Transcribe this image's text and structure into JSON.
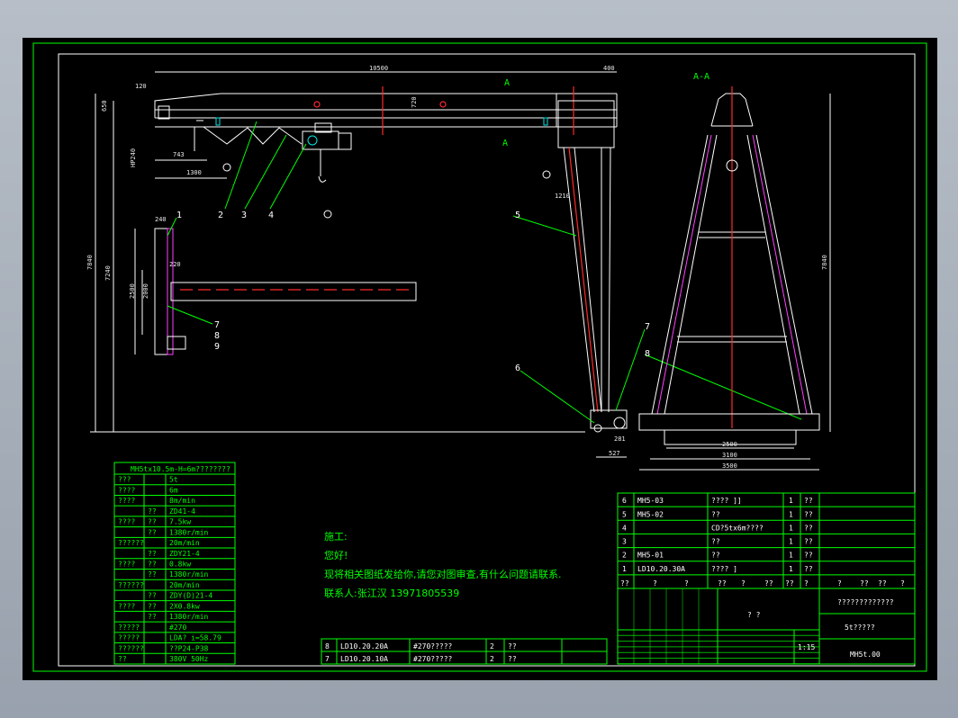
{
  "drawing": {
    "section_label": "A-A",
    "section_mark": "A",
    "overall_width": "10500",
    "overall_width_right": "400",
    "dims_left": [
      "120",
      "650",
      "HP240",
      "743",
      "1300"
    ],
    "dim_small": "1210",
    "dim_center": "720",
    "height_total": "7840",
    "height_inner": "7240",
    "height_right": "7840",
    "plan_dims": [
      "240",
      "220",
      "2500",
      "2000"
    ],
    "base_dims": [
      "281",
      "527"
    ],
    "aa_base_dims": [
      "2500",
      "3100",
      "3500"
    ],
    "part_callouts": [
      "1",
      "2",
      "3",
      "4",
      "5",
      "6",
      "7",
      "8",
      "9"
    ]
  },
  "spec_table": {
    "title": "MH5tx10.5m-H=6m????????",
    "rows": [
      {
        "a": "???",
        "b": "",
        "c": "5t"
      },
      {
        "a": "????",
        "b": "",
        "c": "6m"
      },
      {
        "a": "????",
        "b": "",
        "c": "8m/min"
      },
      {
        "a": "",
        "b": "??",
        "c": "ZD41-4"
      },
      {
        "a": "????",
        "b": "??",
        "c": "7.5kw"
      },
      {
        "a": "",
        "b": "??",
        "c": "1380r/min"
      },
      {
        "a": "??????",
        "b": "",
        "c": "20m/min"
      },
      {
        "a": "",
        "b": "??",
        "c": "ZDY21-4"
      },
      {
        "a": "????",
        "b": "??",
        "c": "0.8kw"
      },
      {
        "a": "",
        "b": "??",
        "c": "1380r/min"
      },
      {
        "a": "??????",
        "b": "",
        "c": "20m/min"
      },
      {
        "a": "",
        "b": "??",
        "c": "ZDY(D)21-4"
      },
      {
        "a": "????",
        "b": "??",
        "c": "2X0.8kw"
      },
      {
        "a": "",
        "b": "??",
        "c": "1380r/min"
      },
      {
        "a": "?????",
        "b": "",
        "c": "#270"
      },
      {
        "a": "?????",
        "b": "",
        "c": "LDA?  i=58.79"
      },
      {
        "a": "??????",
        "b": "",
        "c": "??P24-P38"
      },
      {
        "a": "??",
        "b": "",
        "c": "380V    50Hz"
      }
    ]
  },
  "note": {
    "l1": "施工:",
    "l2": "您好!",
    "l3": "现将相关图纸发给你,请您对图审查,有什么问题请联系.",
    "l4": "联系人:张江汉   13971805539"
  },
  "bom_top": [
    {
      "n": "6",
      "code": "MH5-03",
      "name": "???? ]]",
      "q": "1",
      "x": "??"
    },
    {
      "n": "5",
      "code": "MH5-02",
      "name": "??",
      "q": "1",
      "x": "??"
    },
    {
      "n": "4",
      "code": "",
      "name": "CD?5tx6m????",
      "q": "1",
      "x": "??"
    },
    {
      "n": "3",
      "code": "",
      "name": "??",
      "q": "1",
      "x": "??"
    },
    {
      "n": "2",
      "code": "MH5-01",
      "name": "??",
      "q": "1",
      "x": "??"
    },
    {
      "n": "1",
      "code": "LD10.20.30A",
      "name": "???? ]",
      "q": "1",
      "x": "??"
    }
  ],
  "bom_bottom": [
    {
      "n": "8",
      "code": "LD10.20.20A",
      "name": "#270?????",
      "q": "2",
      "x": "??"
    },
    {
      "n": "7",
      "code": "LD10.20.10A",
      "name": "#270?????",
      "q": "2",
      "x": "??"
    }
  ],
  "header_row": [
    "??",
    "?",
    "?",
    "??",
    "?",
    "??",
    "??",
    "?",
    "?",
    "??",
    "??",
    "?"
  ],
  "title_block": {
    "company": "?????????????",
    "product": "5t?????",
    "drawing_no": "MH5t.00",
    "scale": "1:15",
    "small": "?  ?"
  }
}
